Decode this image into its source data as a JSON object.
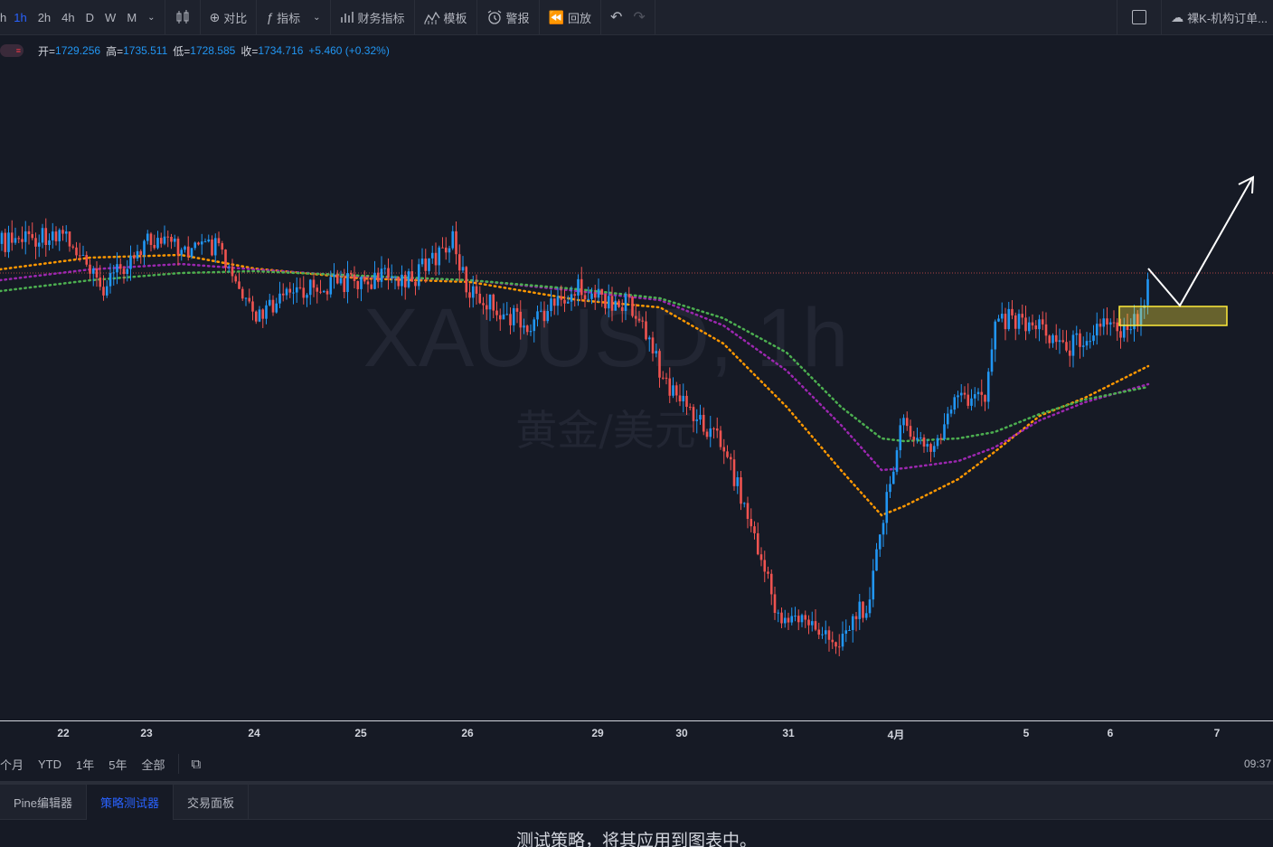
{
  "toolbar": {
    "intervals": [
      "h",
      "1h",
      "2h",
      "4h",
      "D",
      "W",
      "M"
    ],
    "active_interval": "1h",
    "compare_label": "对比",
    "indicators_label": "指标",
    "financials_label": "财务指标",
    "templates_label": "模板",
    "alerts_label": "警报",
    "replay_label": "回放",
    "layout_name": "裸K-机构订单..."
  },
  "legend": {
    "open_label": "开=",
    "open": "1729.256",
    "high_label": "高=",
    "high": "1735.511",
    "low_label": "低=",
    "low": "1728.585",
    "close_label": "收=",
    "close": "1734.716",
    "change": "+5.460 (+0.32%)"
  },
  "watermark": {
    "symbol": "XAUUSD, 1h",
    "description": "黄金/美元"
  },
  "xaxis": {
    "ticks": [
      "22",
      "23",
      "24",
      "25",
      "26",
      "29",
      "30",
      "31",
      "4月",
      "5",
      "6",
      "7"
    ]
  },
  "range_bar": {
    "items": [
      "个月",
      "YTD",
      "1年",
      "5年",
      "全部"
    ],
    "time": "09:37"
  },
  "bottom_tabs": [
    "Pine编辑器",
    "策略测试器",
    "交易面板"
  ],
  "active_bottom_tab": "策略测试器",
  "panel_message": "测试策略，将其应用到图表中。",
  "colors": {
    "up": "#2196f3",
    "down": "#ef5350",
    "ma_fast": "#ff9800",
    "ma_mid": "#9c27b0",
    "ma_slow": "#4caf50",
    "highlight": "#ffeb3b"
  },
  "chart_data": {
    "type": "candlestick",
    "symbol": "XAUUSD",
    "interval": "1h",
    "x": [
      "22",
      "23",
      "24",
      "25",
      "26",
      "29",
      "30",
      "31",
      "4月",
      "5",
      "6"
    ],
    "close": [
      1739,
      1740,
      1726,
      1734,
      1725,
      1728,
      1690,
      1686,
      1730,
      1730,
      1734.716
    ],
    "last_bar": {
      "open": 1729.256,
      "high": 1735.511,
      "low": 1728.585,
      "close": 1734.716
    }
  }
}
